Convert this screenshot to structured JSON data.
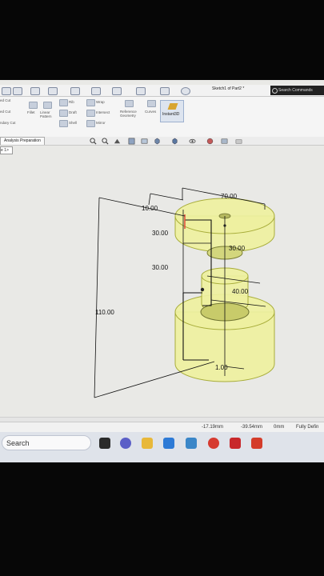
{
  "window": {
    "document_title": "Sketch1 of Part2 *"
  },
  "search_commands": {
    "label": "Search Commands"
  },
  "ribbon": {
    "left_items": [
      "ed Cut",
      "ed Cut",
      "ndary Cut"
    ],
    "fillet": "Fillet",
    "linear_pattern": "Linear Pattern",
    "rib": "Rib",
    "draft": "Draft",
    "shell": "Shell",
    "wrap": "Wrap",
    "intersect": "Intersect",
    "mirror": "Mirror",
    "reference_geometry": "Reference Geometry",
    "curves": "Curves",
    "instant3d": "Instant3D"
  },
  "tabs": {
    "active": "Analysis Preparation"
  },
  "tree_tab": "e 1>",
  "dimensions": {
    "d70": "70.00",
    "d10": "10.00",
    "d30a": "30.00",
    "d30b": "30.00",
    "d30c": "30.00",
    "d110": "110.00",
    "d40": "40.00",
    "d1": "1.00"
  },
  "status": {
    "x": "-17.19mm",
    "y": "-39.54mm",
    "z": "0mm",
    "state": "Fully Defin"
  },
  "taskbar": {
    "search_label": "Search"
  },
  "colors": {
    "model_fill": "#eef0a0",
    "model_stroke": "#a8ad3a",
    "edge": "#111111"
  }
}
